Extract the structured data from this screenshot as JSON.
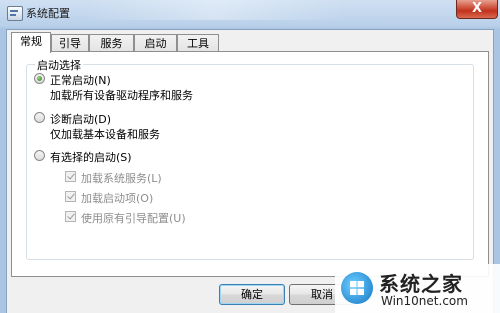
{
  "window": {
    "title": "系统配置",
    "close_glyph": "X"
  },
  "tabs": [
    {
      "label": "常规",
      "active": true
    },
    {
      "label": "引导",
      "active": false
    },
    {
      "label": "服务",
      "active": false
    },
    {
      "label": "启动",
      "active": false
    },
    {
      "label": "工具",
      "active": false
    }
  ],
  "startup": {
    "caption": "启动选择",
    "normal": {
      "label": "正常启动(N)",
      "desc": "加载所有设备驱动程序和服务",
      "selected": true
    },
    "diagnostic": {
      "label": "诊断启动(D)",
      "desc": "仅加载基本设备和服务",
      "selected": false
    },
    "selective": {
      "label": "有选择的启动(S)",
      "selected": false
    },
    "options": [
      {
        "label": "加载系统服务(L)",
        "checked": true,
        "disabled": true
      },
      {
        "label": "加载启动项(O)",
        "checked": true,
        "disabled": true
      },
      {
        "label": "使用原有引导配置(U)",
        "checked": true,
        "disabled": true
      }
    ]
  },
  "buttons": {
    "ok": "确定",
    "cancel": "取消"
  },
  "watermark": {
    "name": "系统之家",
    "url": "Win10net.com"
  },
  "colors": {
    "titlebar": "#b9d0ea",
    "close": "#c9452f",
    "radio_selected": "#2f7d1b"
  }
}
